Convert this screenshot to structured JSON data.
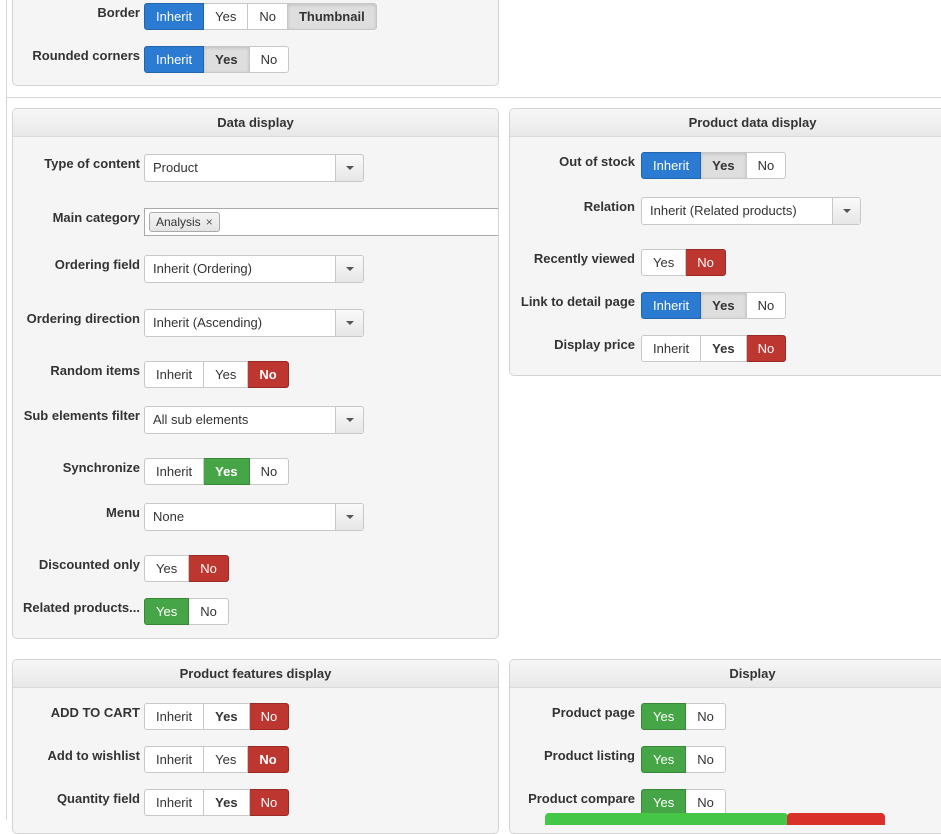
{
  "top_panel": {
    "border": {
      "label": "Border",
      "options": [
        "Inherit",
        "Yes",
        "No",
        "Thumbnail"
      ]
    },
    "rounded": {
      "label": "Rounded corners",
      "options": [
        "Inherit",
        "Yes",
        "No"
      ]
    }
  },
  "data_display": {
    "title": "Data display",
    "type_of_content": {
      "label": "Type of content",
      "value": "Product"
    },
    "main_category": {
      "label": "Main category",
      "tag": "Analysis",
      "remove": "×"
    },
    "ordering_field": {
      "label": "Ordering field",
      "value": "Inherit (Ordering)"
    },
    "ordering_direction": {
      "label": "Ordering direction",
      "value": "Inherit (Ascending)"
    },
    "random_items": {
      "label": "Random items",
      "options": [
        "Inherit",
        "Yes",
        "No"
      ]
    },
    "sub_elements_filter": {
      "label": "Sub elements filter",
      "value": "All sub elements"
    },
    "synchronize": {
      "label": "Synchronize",
      "options": [
        "Inherit",
        "Yes",
        "No"
      ]
    },
    "menu": {
      "label": "Menu",
      "value": "None"
    },
    "discounted_only": {
      "label": "Discounted only",
      "options": [
        "Yes",
        "No"
      ]
    },
    "related_products": {
      "label": "Related products...",
      "options": [
        "Yes",
        "No"
      ]
    }
  },
  "product_data_display": {
    "title": "Product data display",
    "out_of_stock": {
      "label": "Out of stock",
      "options": [
        "Inherit",
        "Yes",
        "No"
      ]
    },
    "relation": {
      "label": "Relation",
      "value": "Inherit (Related products)"
    },
    "recently_viewed": {
      "label": "Recently viewed",
      "options": [
        "Yes",
        "No"
      ]
    },
    "link_to_detail": {
      "label": "Link to detail page",
      "options": [
        "Inherit",
        "Yes",
        "No"
      ]
    },
    "display_price": {
      "label": "Display price",
      "options": [
        "Inherit",
        "Yes",
        "No"
      ]
    }
  },
  "product_features_display": {
    "title": "Product features display",
    "add_to_cart": {
      "label": "ADD TO CART",
      "options": [
        "Inherit",
        "Yes",
        "No"
      ]
    },
    "add_to_wishlist": {
      "label": "Add to wishlist",
      "options": [
        "Inherit",
        "Yes",
        "No"
      ]
    },
    "quantity_field": {
      "label": "Quantity field",
      "options": [
        "Inherit",
        "Yes",
        "No"
      ]
    }
  },
  "display": {
    "title": "Display",
    "product_page": {
      "label": "Product page",
      "options": [
        "Yes",
        "No"
      ]
    },
    "product_listing": {
      "label": "Product listing",
      "options": [
        "Yes",
        "No"
      ]
    },
    "product_compare": {
      "label": "Product compare",
      "options": [
        "Yes",
        "No"
      ]
    }
  },
  "colors": {
    "blue": "#2a7bd1",
    "green": "#46a546",
    "red": "#bd362f",
    "selected_gray": "#dedede"
  }
}
